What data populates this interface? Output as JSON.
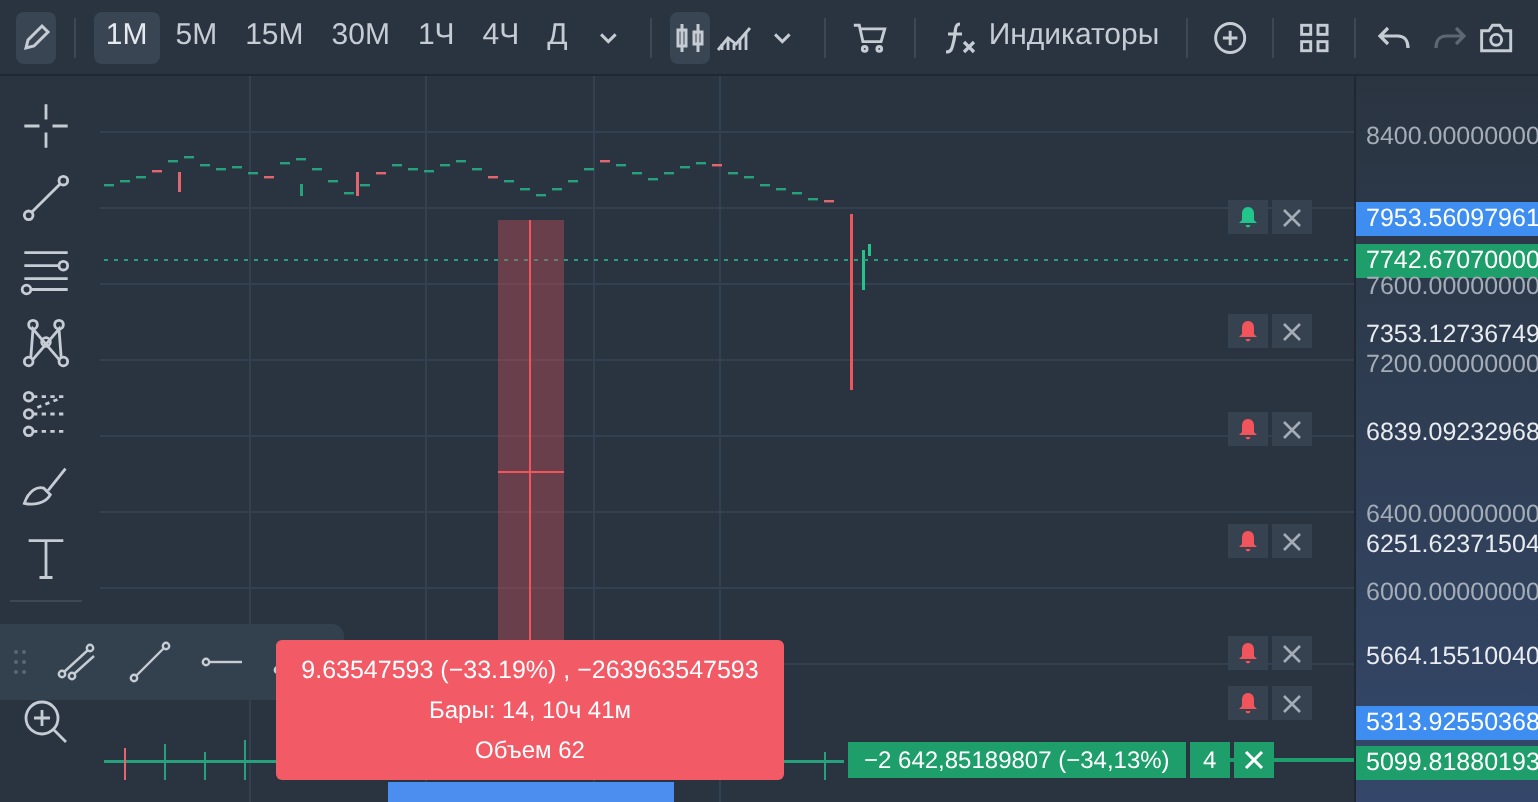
{
  "toolbar": {
    "draw_mode": {
      "selected": true
    },
    "timeframes": [
      {
        "label": "1M",
        "selected": true
      },
      {
        "label": "5M",
        "selected": false
      },
      {
        "label": "15M",
        "selected": false
      },
      {
        "label": "30M",
        "selected": false
      },
      {
        "label": "1Ч",
        "selected": false
      },
      {
        "label": "4Ч",
        "selected": false
      },
      {
        "label": "Д",
        "selected": false
      }
    ],
    "chart_types": [
      {
        "kind": "candles",
        "selected": true
      },
      {
        "kind": "area",
        "selected": false
      }
    ],
    "indicators_label": "Индикаторы",
    "undo": {
      "disabled": false
    },
    "redo": {
      "disabled": true
    }
  },
  "price_axis": [
    {
      "text": "8400.00000000",
      "kind": "tick"
    },
    {
      "text": "7953.56097961",
      "kind": "marker",
      "color": "#3d8ef0"
    },
    {
      "text": "7742.67070000",
      "kind": "marker",
      "color": "#1e9e6a"
    },
    {
      "text": "7600.00000000",
      "kind": "tick"
    },
    {
      "text": "7353.12736749",
      "kind": "alert"
    },
    {
      "text": "7200.00000000",
      "kind": "tick"
    },
    {
      "text": "6839.09232968",
      "kind": "alert"
    },
    {
      "text": "6400.00000000",
      "kind": "tick"
    },
    {
      "text": "6251.62371504",
      "kind": "alert"
    },
    {
      "text": "6000.00000000",
      "kind": "tick"
    },
    {
      "text": "5664.15510040",
      "kind": "alert"
    },
    {
      "text": "5313.92550368",
      "kind": "marker",
      "color": "#3d8ef0"
    },
    {
      "text": "5099.81880193",
      "kind": "marker",
      "color": "#1e9e6a"
    }
  ],
  "alerts": [
    {
      "color": "#22c58b"
    },
    {
      "color": "#f2545b"
    },
    {
      "color": "#f2545b"
    },
    {
      "color": "#f2545b"
    },
    {
      "color": "#f2545b"
    },
    {
      "color": "#f2545b"
    }
  ],
  "measure_tooltip": {
    "lines": [
      "9.63547593 (−33.19%) , −263963547593",
      "Бары: 14, 10ч 41м",
      "Объем 62"
    ]
  },
  "position": {
    "pnl": "−2 642,85189807 (−34,13%)",
    "quantity": "4"
  }
}
